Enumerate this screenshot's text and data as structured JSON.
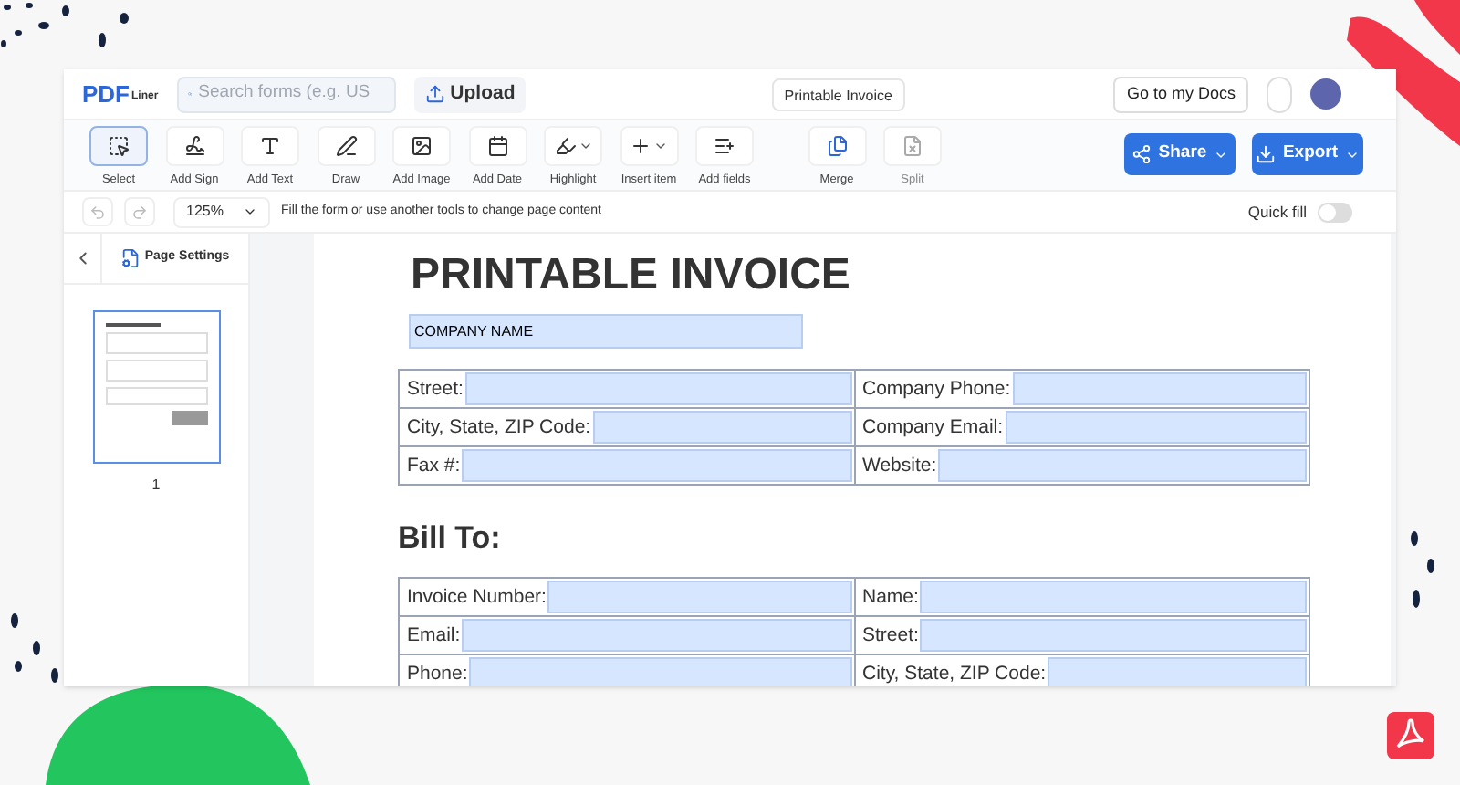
{
  "header": {
    "logo": {
      "main": "PDF",
      "sub": "Liner"
    },
    "search": {
      "placeholder": "Search forms (e.g. US"
    },
    "upload": "Upload",
    "doc_title": "Printable Invoice",
    "docs_button": "Go to my Docs"
  },
  "tools": [
    {
      "label": "Select",
      "selected": true,
      "dropdown": false
    },
    {
      "label": "Add Sign",
      "selected": false,
      "dropdown": false
    },
    {
      "label": "Add Text",
      "selected": false,
      "dropdown": false
    },
    {
      "label": "Draw",
      "selected": false,
      "dropdown": false
    },
    {
      "label": "Add Image",
      "selected": false,
      "dropdown": false
    },
    {
      "label": "Add Date",
      "selected": false,
      "dropdown": false
    },
    {
      "label": "Highlight",
      "selected": false,
      "dropdown": true
    },
    {
      "label": "Insert item",
      "selected": false,
      "dropdown": true
    },
    {
      "label": "Add fields",
      "selected": false,
      "dropdown": false
    }
  ],
  "page_tools": [
    {
      "label": "Merge",
      "disabled": false
    },
    {
      "label": "Split",
      "disabled": true
    }
  ],
  "actions": [
    "Share",
    "Export"
  ],
  "subbar": {
    "zoom": "125%",
    "hint": "Fill the form or use another tools to change page content",
    "quick_fill": {
      "label": "Quick fill",
      "on": false
    }
  },
  "sidebar": {
    "page_settings": "Page Settings",
    "thumbnails": [
      {
        "label": "1",
        "selected": true
      }
    ]
  },
  "document": {
    "title": "PRINTABLE INVOICE",
    "company_field": {
      "value": "COMPANY NAME"
    },
    "company_table": [
      [
        "Street:",
        "Company Phone:"
      ],
      [
        "City, State, ZIP Code:",
        "Company Email:"
      ],
      [
        "Fax #:",
        "Website:"
      ]
    ],
    "bill_heading": "Bill To:",
    "bill_table": [
      [
        "Invoice Number:",
        "Name:"
      ],
      [
        "Email:",
        "Street:"
      ],
      [
        "Phone:",
        "City, State, ZIP Code:"
      ]
    ]
  }
}
